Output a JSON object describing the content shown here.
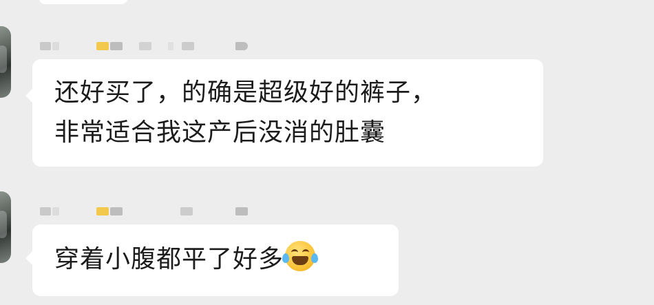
{
  "chat": {
    "background_color": "#ededed",
    "bubble_color": "#ffffff",
    "messages": [
      {
        "sender_name_blurred": true,
        "lines": [
          "还好买了，的确是超级好的裤子，",
          "非常适合我这产后没消的肚囊"
        ]
      },
      {
        "sender_name_blurred": true,
        "lines": [
          "穿着小腹都平了好多"
        ],
        "emoji": "grinning-with-tears-emoji"
      }
    ]
  }
}
